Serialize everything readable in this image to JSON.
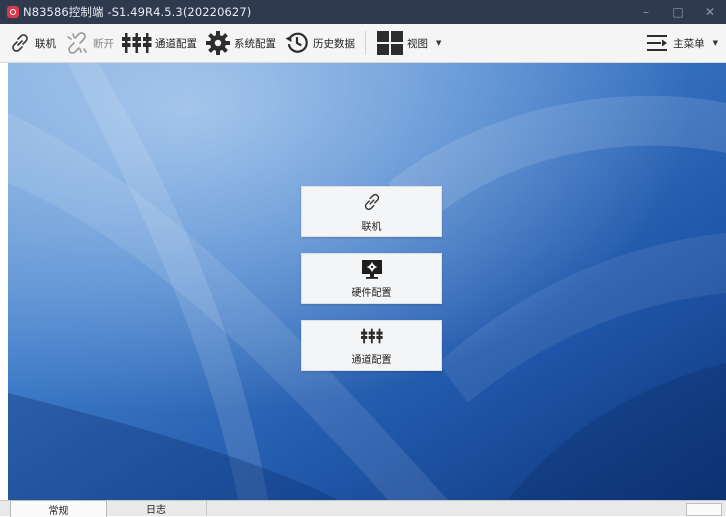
{
  "window": {
    "title": "N83586控制端 -S1.49R4.5.3(20220627)",
    "controls": {
      "minimize": "–",
      "maximize": "□",
      "close": "✕"
    }
  },
  "toolbar": {
    "connect_label": "联机",
    "disconnect_label": "断开",
    "channel_config_label": "通道配置",
    "system_config_label": "系统配置",
    "history_label": "历史数据",
    "view_label": "视图",
    "main_menu_label": "主菜单"
  },
  "tiles": {
    "connect": "联机",
    "hardware_config": "硬件配置",
    "channel_config": "通道配置"
  },
  "tabs": {
    "general": "常规",
    "log": "日志"
  },
  "colors": {
    "titlebar": "#2f3a4f",
    "desktop_blue": "#2a62b8",
    "tile_bg": "#f4f5f6"
  },
  "icons": {
    "connect": "link-icon",
    "disconnect": "broken-link-icon",
    "channel_config": "channel-plugs-icon",
    "system_config": "gear-icon",
    "history": "history-icon",
    "view": "grid-view-icon",
    "main_menu": "menu-icon",
    "hardware": "monitor-gear-icon"
  }
}
